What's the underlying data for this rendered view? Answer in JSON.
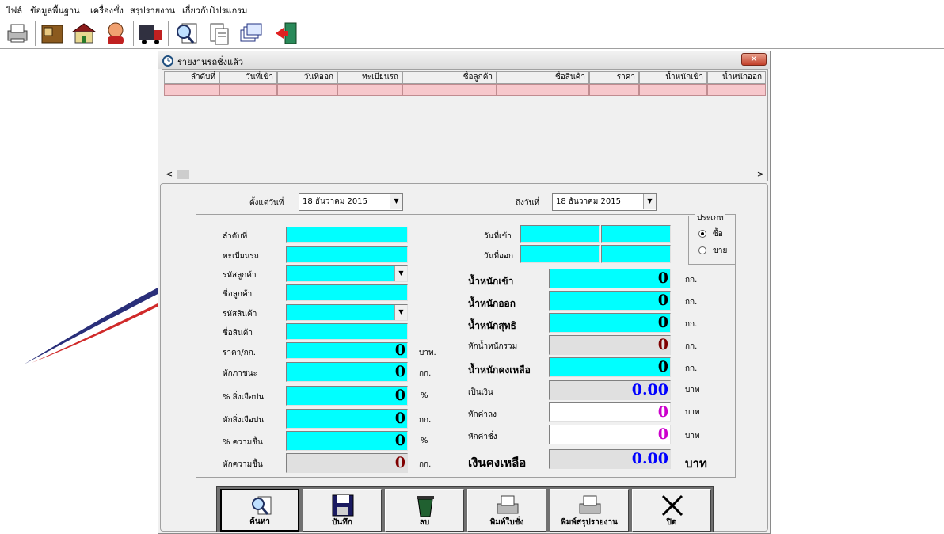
{
  "menu": [
    "ไฟล์",
    "ข้อมูลพื้นฐาน",
    "เครื่องชั่ง",
    "สรุปรายงาน",
    "เกี่ยวกับโปรแกรม"
  ],
  "toolbar_icons": [
    "printer-icon",
    "box-icon",
    "house-icon",
    "person-icon",
    "truck-icon",
    "search-doc-icon",
    "doc-icon",
    "stack-icon",
    "exit-door-icon"
  ],
  "window": {
    "title": "รายงานรถชั่งแล้ว",
    "close": "✕"
  },
  "grid": {
    "columns": [
      "ลำดับที่",
      "วันที่เข้า",
      "วันที่ออก",
      "ทะเบียนรถ",
      "ชื่อลูกค้า",
      "ชื่อสินค้า",
      "ราคา",
      "น้ำหนักเข้า",
      "น้ำหนักออก"
    ]
  },
  "filter": {
    "from_label": "ตั้งแต่วันที่",
    "from_date": "18 ธันวาคม 2015",
    "to_label": "ถึงวันที่",
    "to_date": "18 ธันวาคม 2015"
  },
  "type": {
    "label": "ประเภท",
    "options": [
      "ซื้อ",
      "ขาย"
    ],
    "selected": "ซื้อ"
  },
  "left": {
    "seq": "ลำดับที่",
    "plate": "ทะเบียนรถ",
    "cust_code": "รหัสลูกค้า",
    "cust_name": "ชื่อลูกค้า",
    "prod_code": "รหัสสินค้า",
    "prod_name": "ชื่อสินค้า",
    "price_label": "ราคา/กก.",
    "price": "0",
    "price_unit": "บาท.",
    "container_label": "หักภาชนะ",
    "container": "0",
    "container_unit": "กก.",
    "foreign_pct_label": "% สิ่งเจือปน",
    "foreign_pct": "0",
    "foreign_pct_unit": "%",
    "foreign_label": "หักสิ่งเจือปน",
    "foreign": "0",
    "foreign_unit": "กก.",
    "moist_pct_label": "% ความชื้น",
    "moist_pct": "0",
    "moist_pct_unit": "%",
    "moist_label": "หักความชื้น",
    "moist": "0",
    "moist_unit": "กก."
  },
  "right": {
    "in_date": "วันที่เข้า",
    "out_date": "วันที่ออก",
    "w_in_label": "น้ำหนักเข้า",
    "w_in": "0",
    "w_in_unit": "กก.",
    "w_out_label": "น้ำหนักออก",
    "w_out": "0",
    "w_out_unit": "กก.",
    "w_net_label": "น้ำหนักสุทธิ",
    "w_net": "0",
    "w_net_unit": "กก.",
    "w_ded_label": "หักน้ำหนักรวม",
    "w_ded": "0",
    "w_ded_unit": "กก.",
    "w_rem_label": "น้ำหนักคงเหลือ",
    "w_rem": "0",
    "w_rem_unit": "กก.",
    "money_label": "เป็นเงิน",
    "money": "0.00",
    "money_unit": "บาท",
    "unload_label": "หักค่าลง",
    "unload": "0",
    "unload_unit": "บาท",
    "weigh_label": "หักค่าชั่ง",
    "weigh": "0",
    "weigh_unit": "บาท",
    "balance_label": "เงินคงเหลือ",
    "balance": "0.00",
    "balance_unit": "บาท"
  },
  "buttons": [
    "ค้นหา",
    "บันทึก",
    "ลบ",
    "พิมพ์ใบชั่ง",
    "พิมพ์สรุปรายงาน",
    "ปิด"
  ],
  "colors": {
    "field": "#00ffff",
    "grid_row": "#f7c8cc",
    "money": "#0000ff",
    "deduct": "#800000",
    "purple": "#cc00cc"
  }
}
